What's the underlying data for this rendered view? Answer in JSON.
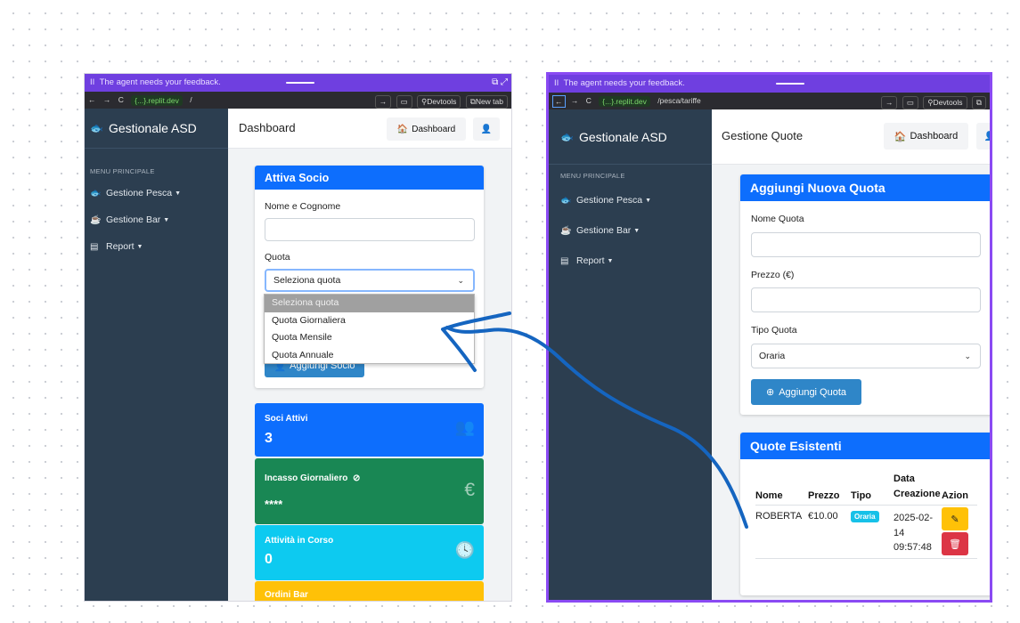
{
  "left": {
    "banner": "The agent needs your feedback.",
    "url": {
      "back": "←",
      "forward": "→",
      "reload": "C",
      "host": "{...}.replit.dev",
      "path": "/",
      "devtools": "Devtools",
      "newtab": "New tab"
    },
    "brand": "Gestionale ASD",
    "menu_header": "MENU PRINCIPALE",
    "menu": [
      {
        "label": "Gestione Pesca",
        "icon": "fish-icon"
      },
      {
        "label": "Gestione Bar",
        "icon": "coffee-icon"
      },
      {
        "label": "Report",
        "icon": "chart-icon"
      }
    ],
    "page_title": "Dashboard",
    "dashboard_button": "Dashboard",
    "form": {
      "title": "Attiva Socio",
      "name_label": "Nome e Cognome",
      "name_value": "",
      "quota_label": "Quota",
      "quota_selected": "Seleziona quota",
      "options": [
        "Seleziona quota",
        "Quota Giornaliera",
        "Quota Mensile",
        "Quota Annuale"
      ],
      "submit": "Aggiungi Socio"
    },
    "stats": [
      {
        "title": "Soci Attivi",
        "value": "3",
        "color": "#0d6efd"
      },
      {
        "title": "Incasso Giornaliero",
        "value": "****",
        "color": "#198754"
      },
      {
        "title": "Attività in Corso",
        "value": "0",
        "color": "#0dcaf0"
      },
      {
        "title": "Ordini Bar",
        "value": "",
        "color": "#ffc107"
      }
    ]
  },
  "right": {
    "banner": "The agent needs your feedback.",
    "url": {
      "back": "←",
      "forward": "→",
      "reload": "C",
      "host": "{...}.replit.dev",
      "path": "/pesca/tariffe",
      "devtools": "Devtools"
    },
    "brand": "Gestionale ASD",
    "menu_header": "MENU PRINCIPALE",
    "menu": [
      {
        "label": "Gestione Pesca",
        "icon": "fish-icon"
      },
      {
        "label": "Gestione Bar",
        "icon": "coffee-icon"
      },
      {
        "label": "Report",
        "icon": "chart-icon"
      }
    ],
    "page_title": "Gestione Quote",
    "dashboard_button": "Dashboard",
    "form": {
      "title": "Aggiungi Nuova Quota",
      "name_label": "Nome Quota",
      "name_value": "",
      "price_label": "Prezzo (€)",
      "price_value": "",
      "type_label": "Tipo Quota",
      "type_selected": "Oraria",
      "submit": "Aggiungi Quota"
    },
    "table": {
      "title": "Quote Esistenti",
      "headers": [
        "Nome",
        "Prezzo",
        "Tipo",
        "Data Creazione",
        "Azion"
      ],
      "rows": [
        {
          "nome": "ROBERTA",
          "prezzo": "€10.00",
          "tipo": "Oraria",
          "data": "2025-02-14 09:57:48"
        }
      ]
    }
  },
  "annotation_color": "#1565c0"
}
